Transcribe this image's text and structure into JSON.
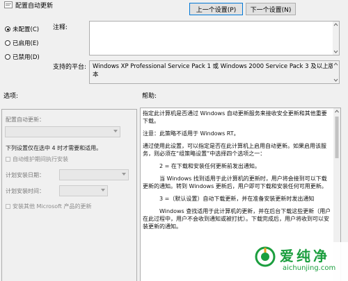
{
  "window": {
    "title": "配置自动更新"
  },
  "nav": {
    "prev_label": "上一个设置(P)",
    "next_label": "下一个设置(N)"
  },
  "state": {
    "options": [
      {
        "label": "未配置(C)",
        "selected": true
      },
      {
        "label": "已启用(E)",
        "selected": false
      },
      {
        "label": "已禁用(D)",
        "selected": false
      }
    ]
  },
  "comment": {
    "label": "注释:",
    "value": ""
  },
  "platform": {
    "label": "支持的平台:",
    "value": "Windows XP Professional Service Pack 1 或 Windows 2000 Service Pack 3 及以上版本"
  },
  "options_section": {
    "label": "选项:",
    "configure_label": "配置自动更新：",
    "configure_value": "",
    "note": "下列设置仅在选中 4 时才需要和适用。",
    "maintenance_label": "自动维护期间执行安装",
    "day_label": "计划安装日期：",
    "day_value": "",
    "time_label": "计划安装时间：",
    "time_value": "",
    "other_label": "安装其他 Microsoft 产品的更新"
  },
  "help_section": {
    "label": "帮助:",
    "paragraphs": [
      "指定此计算机是否通过 Windows 自动更新服务来接收安全更新和其他重要下载。",
      "注意：此策略不适用于 Windows RT。",
      "通过使用此设置，可以指定是否在此计算机上启用自动更新。如果启用该服务，则必须在“组策略设置”中选择四个选项之一：",
      "2 = 在下载和安装任何更新前发出通知。",
      "当 Windows 找到适用于此计算机的更新时，用户将会接到可以下载更新的通知。转到 Windows 更新后，用户即可下载和安装任何可用更新。",
      "3 =（默认设置）自动下载更新，并在准备安装更新时发出通知",
      "Windows 查找适用于此计算机的更新，并在后台下载这些更新（用户在此过程中，用户不会收到通知或被打扰）。下载完成后，用户将收到可以安装更新的通知。"
    ]
  },
  "watermark": {
    "text": "爱纯净",
    "url": "aichunjing.com"
  },
  "colors": {
    "bg": "#f0f0f0",
    "border": "#adadad",
    "focus": "#0078d7",
    "wm_green": "#1b9e3e"
  }
}
